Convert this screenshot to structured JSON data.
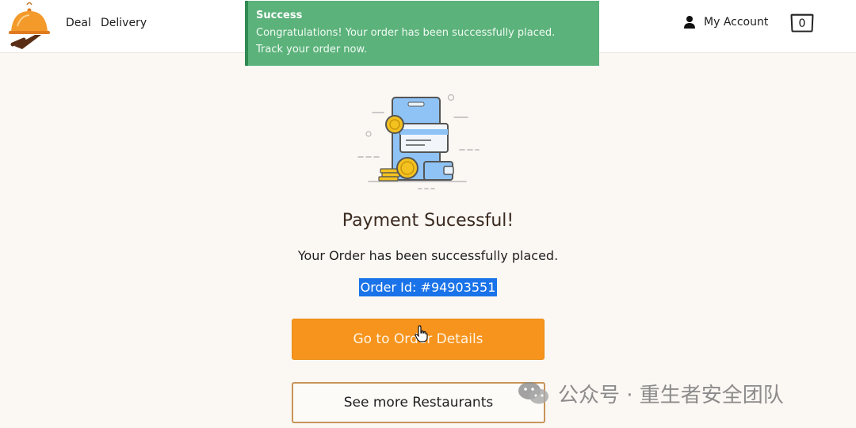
{
  "header": {
    "nav": [
      "Deal",
      "Delivery"
    ],
    "account_label": "My Account",
    "cart_count": "0"
  },
  "toast": {
    "title": "Success",
    "line1": "Congratulations! Your order has been successfully placed.",
    "line2": "Track your order now.",
    "color": "#5bb27a"
  },
  "main": {
    "title": "Payment Sucessful!",
    "subtitle": "Your Order has been successfully placed.",
    "order_id": "Order Id: #94903551",
    "primary_button": "Go to Order Details",
    "secondary_button": "See more Restaurants"
  },
  "watermark": {
    "text": "公众号 · 重生者安全团队",
    "icon": "wechat-icon"
  },
  "icons": {
    "logo": "cloche-logo-icon",
    "account": "user-icon",
    "cart": "cart-icon",
    "illustration": "payment-illustration"
  },
  "colors": {
    "accent": "#f7941d",
    "success": "#5bb27a",
    "selection": "#1a73e8",
    "outline": "#c89458"
  }
}
